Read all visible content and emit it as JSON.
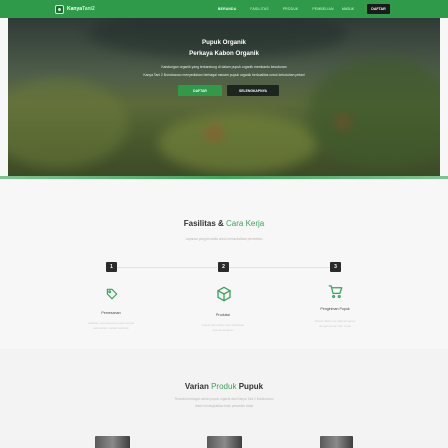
{
  "nav": {
    "logo_prefix": "Kanya",
    "logo_accent": "Tani",
    "logo_suffix": "2",
    "items": [
      "BERANDA",
      "FASILITAS",
      "PRODUK",
      "PEMBELIAN"
    ],
    "login": "MASUK",
    "register": "DAFTAR"
  },
  "hero": {
    "title_line1": "Pupuk Organik",
    "title_line2": "Perkaya Kabon Organik",
    "sub_line1": "Kandungan organik yang terkandung di dalam pupuk organik membantu kesuburan",
    "sub_line2": "Kanya Tani 2 Bondowoso menyediakan berbagai macam pupuk organik berkualitas untuk kebutuhan petani",
    "cta_primary": "DAFTAR",
    "cta_secondary": "SELENGKAPNYA"
  },
  "features": {
    "title_main": "Fasilitas &",
    "title_accent": "Cara Kerja",
    "subtitle": "Layanan yang tersedia untuk memudahkan pembelian",
    "steps": [
      "1",
      "2",
      "3"
    ],
    "items": [
      {
        "label": "Pemesanan",
        "icon": "tag-icon",
        "desc_line1": "Lakukan pemesanan pupuk sesuai",
        "desc_line2": "kebutuhan melalui website"
      },
      {
        "label": "Produksi",
        "icon": "box-icon",
        "desc_line1": "Pupuk diproduksi dan disiapkan",
        "desc_line2": "sesuai pesanan"
      },
      {
        "label": "Pengiriman Pupuk",
        "icon": "cart-icon",
        "desc_line1": "Pupuk dikirim ke alamat tujuan",
        "desc_line2": "dengan aman dan cepat"
      }
    ]
  },
  "products": {
    "title_prefix": "Varian",
    "title_accent": "Produk",
    "title_suffix": "Pupuk",
    "sub_line1": "Tersedia berbagai varian pupuk organik dari Kanya Tani 2 Bondowoso",
    "sub_line2": "untuk meningkatkan hasil pertanian Anda"
  },
  "colors": {
    "brand": "#2e9a4a",
    "accent_text": "#3aa35a",
    "dark_button": "#1b1b1b"
  }
}
